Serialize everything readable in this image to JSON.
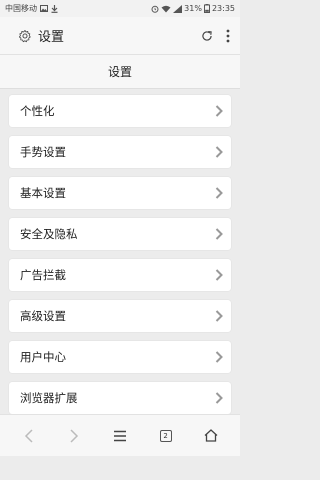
{
  "status_bar": {
    "carrier": "中国移动",
    "battery": "31%",
    "time": "23:35",
    "icons": [
      "image-icon",
      "download-icon",
      "alarm-icon",
      "wifi-icon",
      "signal-icon",
      "battery-icon"
    ]
  },
  "address_bar": {
    "icon": "gear-icon",
    "title": "设置",
    "actions": [
      "refresh-icon",
      "more-vertical-icon"
    ]
  },
  "page": {
    "title": "设置"
  },
  "menu": {
    "items": [
      {
        "label": "个性化"
      },
      {
        "label": "手势设置"
      },
      {
        "label": "基本设置"
      },
      {
        "label": "安全及隐私"
      },
      {
        "label": "广告拦截"
      },
      {
        "label": "高级设置"
      },
      {
        "label": "用户中心"
      },
      {
        "label": "浏览器扩展"
      }
    ]
  },
  "bottom_nav": {
    "tab_count": "2",
    "buttons": [
      "back-icon",
      "forward-icon",
      "menu-icon",
      "tabs-icon",
      "home-icon"
    ]
  }
}
